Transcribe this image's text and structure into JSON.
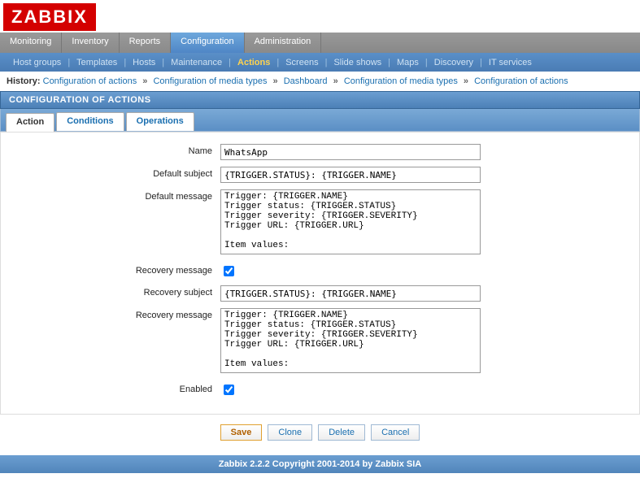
{
  "logo": "ZABBIX",
  "main_nav": {
    "items": [
      "Monitoring",
      "Inventory",
      "Reports",
      "Configuration",
      "Administration"
    ],
    "active_index": 3
  },
  "sub_nav": {
    "items": [
      "Host groups",
      "Templates",
      "Hosts",
      "Maintenance",
      "Actions",
      "Screens",
      "Slide shows",
      "Maps",
      "Discovery",
      "IT services"
    ],
    "active_index": 4
  },
  "history": {
    "label": "History:",
    "crumbs": [
      "Configuration of actions",
      "Configuration of media types",
      "Dashboard",
      "Configuration of media types",
      "Configuration of actions"
    ]
  },
  "page_title": "CONFIGURATION OF ACTIONS",
  "form_tabs": {
    "items": [
      "Action",
      "Conditions",
      "Operations"
    ],
    "active_index": 0
  },
  "form": {
    "name_label": "Name",
    "name_value": "WhatsApp",
    "default_subject_label": "Default subject",
    "default_subject_value": "{TRIGGER.STATUS}: {TRIGGER.NAME}",
    "default_message_label": "Default message",
    "default_message_value": "Trigger: {TRIGGER.NAME}\nTrigger status: {TRIGGER.STATUS}\nTrigger severity: {TRIGGER.SEVERITY}\nTrigger URL: {TRIGGER.URL}\n\nItem values:\n",
    "recovery_check_label": "Recovery message",
    "recovery_check_value": true,
    "recovery_subject_label": "Recovery subject",
    "recovery_subject_value": "{TRIGGER.STATUS}: {TRIGGER.NAME}",
    "recovery_message_label": "Recovery message",
    "recovery_message_value": "Trigger: {TRIGGER.NAME}\nTrigger status: {TRIGGER.STATUS}\nTrigger severity: {TRIGGER.SEVERITY}\nTrigger URL: {TRIGGER.URL}\n\nItem values:\n",
    "enabled_label": "Enabled",
    "enabled_value": true
  },
  "buttons": {
    "save": "Save",
    "clone": "Clone",
    "delete": "Delete",
    "cancel": "Cancel"
  },
  "footer": "Zabbix 2.2.2 Copyright 2001-2014 by Zabbix SIA"
}
